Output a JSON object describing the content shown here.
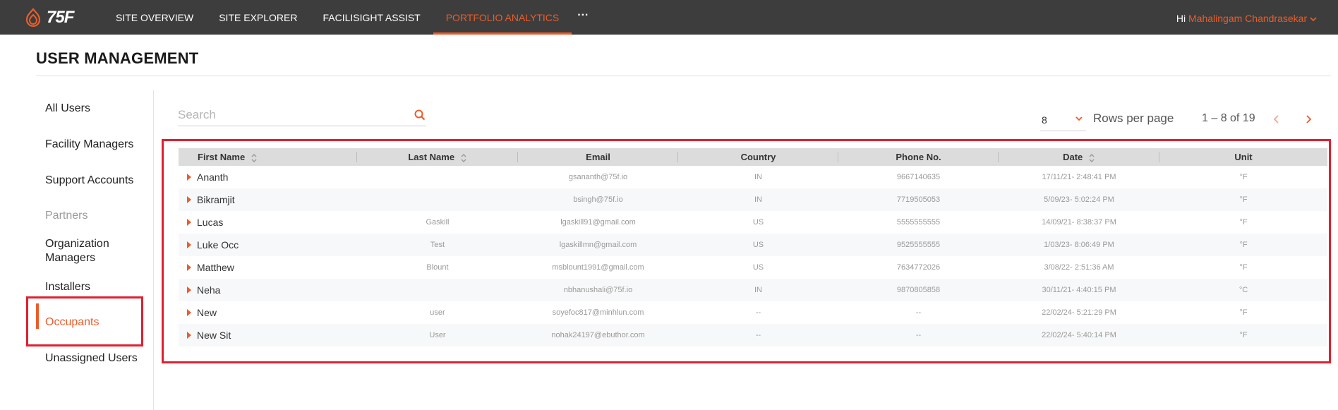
{
  "app": {
    "logo_text": "75F"
  },
  "nav": {
    "items": [
      {
        "label": "SITE OVERVIEW"
      },
      {
        "label": "SITE EXPLORER"
      },
      {
        "label": "FACILISIGHT ASSIST"
      },
      {
        "label": "PORTFOLIO ANALYTICS",
        "active": true
      }
    ],
    "more_label": "···"
  },
  "user": {
    "greeting": "Hi",
    "name": "Mahalingam Chandrasekar"
  },
  "page": {
    "title": "USER MANAGEMENT"
  },
  "sidebar": {
    "items": [
      {
        "label": "All Users"
      },
      {
        "label": "Facility Managers"
      },
      {
        "label": "Support Accounts"
      },
      {
        "label": "Partners",
        "muted": true
      },
      {
        "label": "Organization Managers"
      },
      {
        "label": "Installers"
      },
      {
        "label": "Occupants",
        "active": true
      },
      {
        "label": "Unassigned Users"
      }
    ]
  },
  "search": {
    "placeholder": "Search",
    "value": ""
  },
  "pagination": {
    "rows_per_page_value": "8",
    "rows_per_page_label": "Rows per page",
    "range": "1 – 8 of 19"
  },
  "table": {
    "columns": [
      "First Name",
      "Last Name",
      "Email",
      "Country",
      "Phone No.",
      "Date",
      "Unit"
    ],
    "rows": [
      [
        "Ananth",
        "",
        "gsananth@75f.io",
        "IN",
        "9667140635",
        "17/11/21- 2:48:41 PM",
        "°F"
      ],
      [
        "Bikramjit",
        "",
        "bsingh@75f.io",
        "IN",
        "7719505053",
        "5/09/23- 5:02:24 PM",
        "°F"
      ],
      [
        "Lucas",
        "Gaskill",
        "lgaskill91@gmail.com",
        "US",
        "5555555555",
        "14/09/21- 8:38:37 PM",
        "°F"
      ],
      [
        "Luke Occ",
        "Test",
        "lgaskillmn@gmail.com",
        "US",
        "9525555555",
        "1/03/23- 8:06:49 PM",
        "°F"
      ],
      [
        "Matthew",
        "Blount",
        "msblount1991@gmail.com",
        "US",
        "7634772026",
        "3/08/22- 2:51:36 AM",
        "°F"
      ],
      [
        "Neha",
        "",
        "nbhanushali@75f.io",
        "IN",
        "9870805858",
        "30/11/21- 4:40:15 PM",
        "°C"
      ],
      [
        "New",
        "user",
        "soyefoc817@minhlun.com",
        "--",
        "--",
        "22/02/24- 5:21:29 PM",
        "°F"
      ],
      [
        "New Sit",
        "User",
        "nohak24197@ebuthor.com",
        "--",
        "--",
        "22/02/24- 5:40:14 PM",
        "°F"
      ]
    ]
  },
  "colors": {
    "accent": "#e95d2b",
    "topbar": "#3d3d3d",
    "highlight": "#e0202f"
  },
  "icons": [
    "logo-flame-icon",
    "more-icon",
    "chevron-down-icon",
    "search-icon",
    "sort-icon",
    "chevron-left-icon",
    "chevron-right-icon",
    "expand-caret-icon"
  ]
}
